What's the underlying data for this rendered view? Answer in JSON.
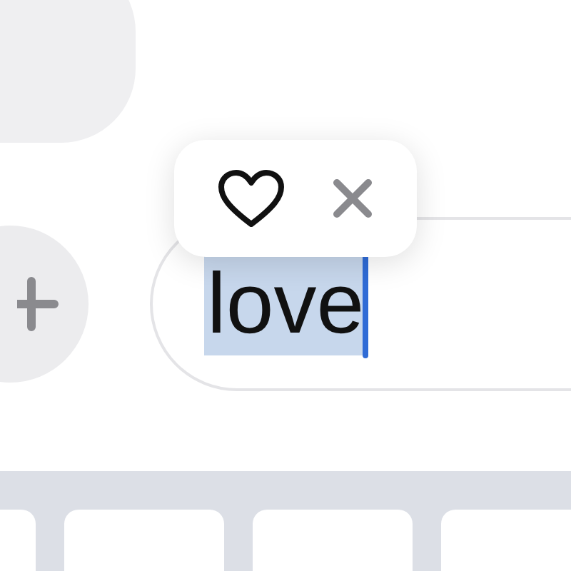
{
  "input": {
    "value": "love",
    "selected": true
  },
  "popup": {
    "items": [
      {
        "kind": "heart"
      },
      {
        "kind": "close"
      }
    ]
  }
}
